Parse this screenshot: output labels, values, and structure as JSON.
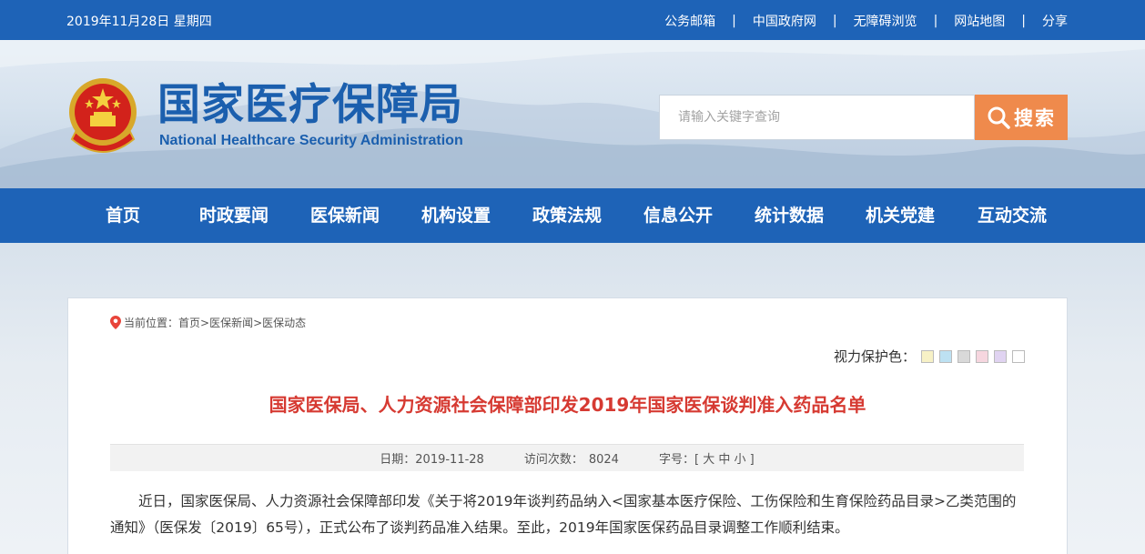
{
  "topbar": {
    "date": "2019年11月28日 星期四",
    "links": [
      "公务邮箱",
      "中国政府网",
      "无障碍浏览",
      "网站地图",
      "分享"
    ],
    "separator": "|"
  },
  "header": {
    "logo_cn": "国家医疗保障局",
    "logo_en": "National Healthcare Security Administration",
    "search_placeholder": "请输入关键字查询",
    "search_button": "搜索"
  },
  "nav": {
    "items": [
      "首页",
      "时政要闻",
      "医保新闻",
      "机构设置",
      "政策法规",
      "信息公开",
      "统计数据",
      "机关党建",
      "互动交流"
    ]
  },
  "breadcrumb": {
    "prefix": "当前位置：",
    "items": [
      "首页",
      "医保新闻",
      "医保动态"
    ],
    "sep": ">"
  },
  "eye_protect": {
    "label": "视力保护色：",
    "swatches": [
      "#f7f1c6",
      "#bde1f2",
      "#d9d9d9",
      "#f6d6df",
      "#e0d3f1",
      "#ffffff"
    ]
  },
  "article": {
    "title": "国家医保局、人力资源社会保障部印发2019年国家医保谈判准入药品名单",
    "date_label": "日期：",
    "date": "2019-11-28",
    "visits_label": "访问次数：",
    "visits": "8024",
    "font_label": "字号：",
    "font_open": "[",
    "font_sizes": [
      "大",
      "中",
      "小"
    ],
    "font_close": "]",
    "body": "近日，国家医保局、人力资源社会保障部印发《关于将2019年谈判药品纳入<国家基本医疗保险、工伤保险和生育保险药品目录>乙类范围的通知》（医保发〔2019〕65号），正式公布了谈判药品准入结果。至此，2019年国家医保药品目录调整工作顺利结束。"
  }
}
